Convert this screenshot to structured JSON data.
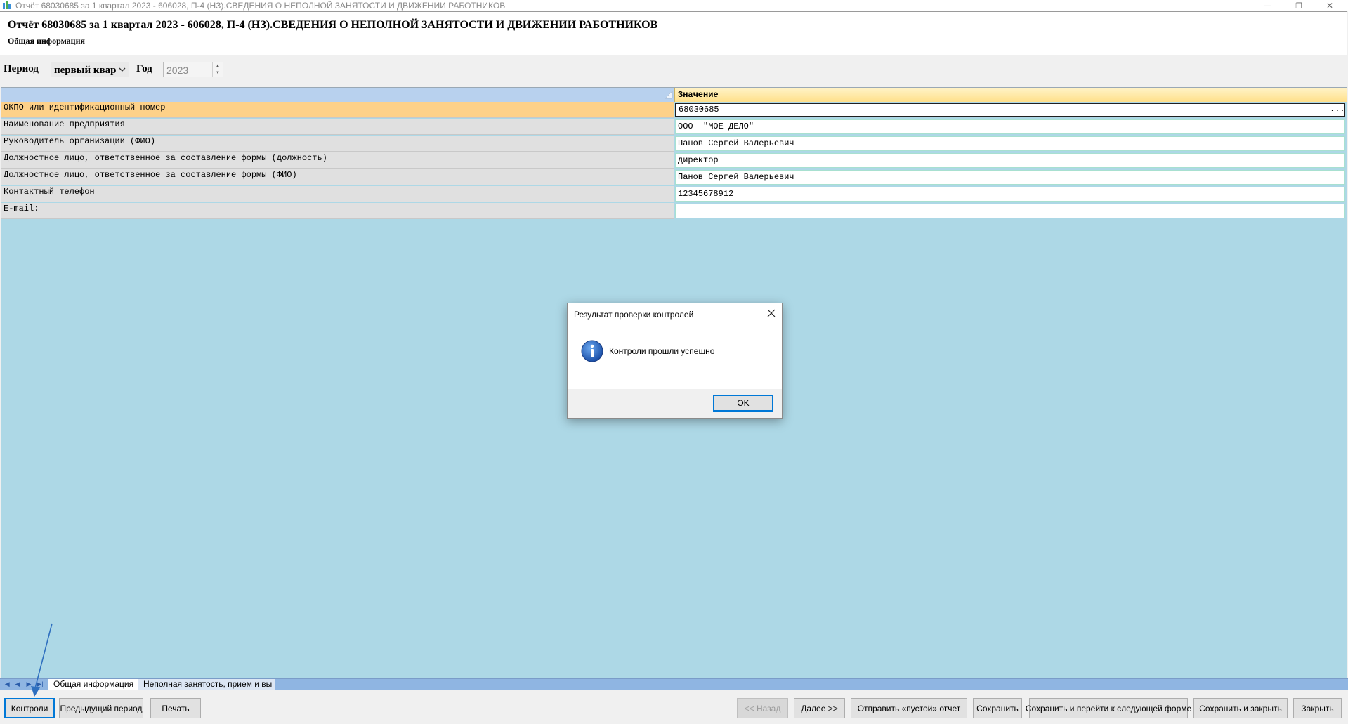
{
  "window": {
    "title": "Отчёт 68030685 за 1 квартал 2023 - 606028, П-4 (НЗ).СВЕДЕНИЯ О НЕПОЛНОЙ ЗАНЯТОСТИ И ДВИЖЕНИИ РАБОТНИКОВ",
    "controls": {
      "minimize": "—",
      "restore": "❐",
      "close": "✕"
    }
  },
  "header": {
    "title": "Отчёт 68030685 за 1 квартал 2023 - 606028, П-4 (НЗ).СВЕДЕНИЯ О НЕПОЛНОЙ ЗАНЯТОСТИ И ДВИЖЕНИИ РАБОТНИКОВ",
    "subtitle": "Общая информация"
  },
  "period": {
    "period_label": "Период",
    "period_value": "первый квартал",
    "year_label": "Год",
    "year_value": "2023"
  },
  "grid": {
    "value_header": "Значение",
    "rows": [
      {
        "label": "ОКПО или идентификационный номер",
        "value": "68030685",
        "dots": "..."
      },
      {
        "label": "Наименование предприятия",
        "value": "ООО  \"МОЕ ДЕЛО\""
      },
      {
        "label": "Руководитель организации (ФИО)",
        "value": "Панов Сергей Валерьевич"
      },
      {
        "label": "Должностное лицо, ответственное за составление формы (должность)",
        "value": "директор"
      },
      {
        "label": "Должностное лицо, ответственное за составление формы (ФИО)",
        "value": "Панов Сергей Валерьевич"
      },
      {
        "label": "Контактный телефон",
        "value": "12345678912"
      },
      {
        "label": "E-mail:",
        "value": ""
      }
    ]
  },
  "tabs": {
    "items": [
      "Общая информация",
      "Неполная занятость, прием и вы"
    ]
  },
  "buttons": {
    "controls": "Контроли",
    "prev_period": "Предыдущий период",
    "print": "Печать",
    "back": "<< Назад",
    "next": "Далее >>",
    "send_empty": "Отправить «пустой» отчет",
    "save": "Сохранить",
    "save_next": "Сохранить и перейти к следующей форме",
    "save_close": "Сохранить и закрыть",
    "close": "Закрыть"
  },
  "dialog": {
    "title": "Результат проверки контролей",
    "message": "Контроли прошли успешно",
    "ok": "OK",
    "icon": "info-icon"
  },
  "colors": {
    "grid_bg": "#add8e6",
    "selected_row": "#fdd189",
    "accent": "#0078d7",
    "annotation_arrow": "#2f6fbf"
  }
}
